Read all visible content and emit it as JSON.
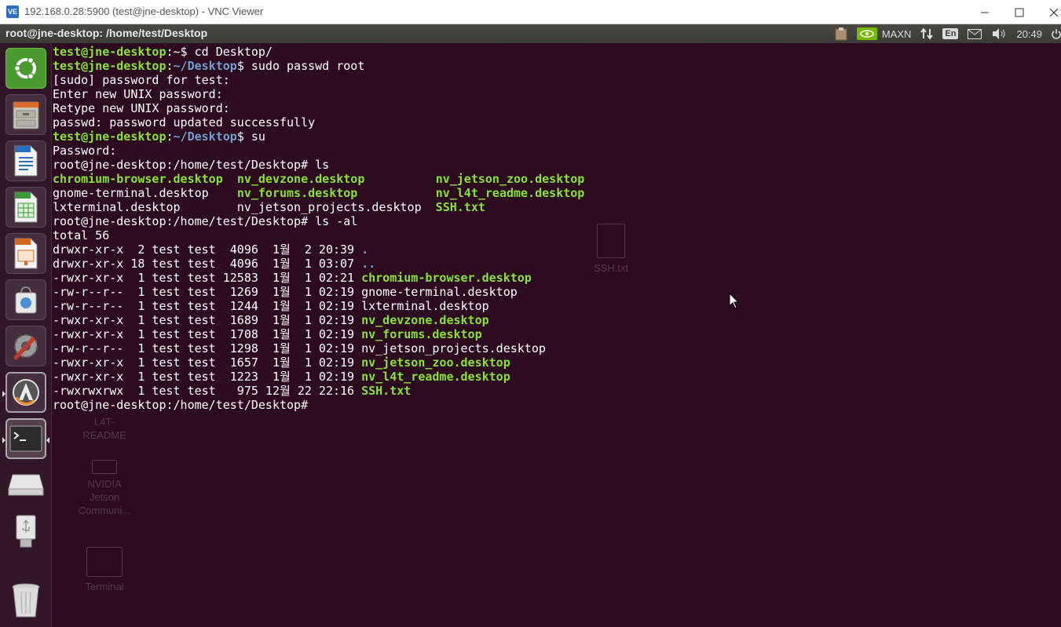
{
  "vnc_window": {
    "icon_label": "VE",
    "title": "192.168.0.28:5900 (test@jne-desktop) - VNC Viewer",
    "controls": [
      "minimize",
      "maximize",
      "close"
    ]
  },
  "top_panel": {
    "title": "root@jne-desktop: /home/test/Desktop",
    "tray": {
      "power_mode": "MAXN",
      "keyboard": "En",
      "clock": "20:49"
    }
  },
  "launcher": {
    "items": [
      {
        "name": "ubuntu-dash",
        "icon": "ubuntu-logo-icon"
      },
      {
        "name": "files",
        "icon": "file-cabinet-icon"
      },
      {
        "name": "libreoffice-writer",
        "icon": "writer-doc-icon"
      },
      {
        "name": "libreoffice-calc",
        "icon": "calc-sheet-icon"
      },
      {
        "name": "libreoffice-impress",
        "icon": "impress-slide-icon"
      },
      {
        "name": "software-center",
        "icon": "shopping-bag-icon"
      },
      {
        "name": "system-settings",
        "icon": "gear-wrench-icon"
      },
      {
        "name": "software-updater",
        "icon": "updater-icon"
      },
      {
        "name": "terminal",
        "icon": "terminal-icon"
      },
      {
        "name": "drive",
        "icon": "drive-icon"
      },
      {
        "name": "usb",
        "icon": "usb-icon"
      },
      {
        "name": "trash",
        "icon": "trash-icon"
      }
    ]
  },
  "desktop_icons": {
    "ssh": "SSH.txt",
    "l4t": [
      "L4T-",
      "README"
    ],
    "nvidia": [
      "NVIDIA",
      "Jetson",
      "Communi..."
    ],
    "terminal": "Terminal"
  },
  "colors": {
    "prompt_green": "#8ae234",
    "path_blue": "#729fcf",
    "background": "#2c0b1f",
    "panel": "#3b3a36"
  },
  "terminal": {
    "prompt_user": "test@jne-desktop",
    "lines": [
      {
        "segments": [
          [
            "g",
            "test@jne-desktop"
          ],
          [
            "w",
            ":~$ cd Desktop/"
          ]
        ]
      },
      {
        "segments": [
          [
            "g",
            "test@jne-desktop"
          ],
          [
            "w",
            ":"
          ],
          [
            "b",
            "~/Desktop"
          ],
          [
            "w",
            "$ sudo passwd root"
          ]
        ]
      },
      {
        "segments": [
          [
            "w",
            "[sudo] password for test:"
          ]
        ]
      },
      {
        "segments": [
          [
            "w",
            "Enter new UNIX password:"
          ]
        ]
      },
      {
        "segments": [
          [
            "w",
            "Retype new UNIX password:"
          ]
        ]
      },
      {
        "segments": [
          [
            "w",
            "passwd: password updated successfully"
          ]
        ]
      },
      {
        "segments": [
          [
            "g",
            "test@jne-desktop"
          ],
          [
            "w",
            ":"
          ],
          [
            "b",
            "~/Desktop"
          ],
          [
            "w",
            "$ su"
          ]
        ]
      },
      {
        "segments": [
          [
            "w",
            "Password:"
          ]
        ]
      },
      {
        "segments": [
          [
            "w",
            "root@jne-desktop:/home/test/Desktop# ls"
          ]
        ]
      },
      {
        "segments": [
          [
            "g",
            "chromium-browser.desktop"
          ],
          [
            "w",
            "  "
          ],
          [
            "g",
            "nv_devzone.desktop"
          ],
          [
            "w",
            "          "
          ],
          [
            "g",
            "nv_jetson_zoo.desktop"
          ]
        ]
      },
      {
        "segments": [
          [
            "w",
            "gnome-terminal.desktop    "
          ],
          [
            "g",
            "nv_forums.desktop"
          ],
          [
            "w",
            "           "
          ],
          [
            "g",
            "nv_l4t_readme.desktop"
          ]
        ]
      },
      {
        "segments": [
          [
            "w",
            "lxterminal.desktop        nv_jetson_projects.desktop  "
          ],
          [
            "g",
            "SSH.txt"
          ]
        ]
      },
      {
        "segments": [
          [
            "w",
            "root@jne-desktop:/home/test/Desktop# ls -al"
          ]
        ]
      },
      {
        "segments": [
          [
            "w",
            "total 56"
          ]
        ]
      },
      {
        "segments": [
          [
            "w",
            "drwxr-xr-x  2 test test  4096  1월  2 20:39 "
          ],
          [
            "b",
            "."
          ]
        ]
      },
      {
        "segments": [
          [
            "w",
            "drwxr-xr-x 18 test test  4096  1월  1 03:07 "
          ],
          [
            "b",
            ".."
          ]
        ]
      },
      {
        "segments": [
          [
            "w",
            "-rwxr-xr-x  1 test test 12583  1월  1 02:21 "
          ],
          [
            "g",
            "chromium-browser.desktop"
          ]
        ]
      },
      {
        "segments": [
          [
            "w",
            "-rw-r--r--  1 test test  1269  1월  1 02:19 gnome-terminal.desktop"
          ]
        ]
      },
      {
        "segments": [
          [
            "w",
            "-rw-r--r--  1 test test  1244  1월  1 02:19 lxterminal.desktop"
          ]
        ]
      },
      {
        "segments": [
          [
            "w",
            "-rwxr-xr-x  1 test test  1689  1월  1 02:19 "
          ],
          [
            "g",
            "nv_devzone.desktop"
          ]
        ]
      },
      {
        "segments": [
          [
            "w",
            "-rwxr-xr-x  1 test test  1708  1월  1 02:19 "
          ],
          [
            "g",
            "nv_forums.desktop"
          ]
        ]
      },
      {
        "segments": [
          [
            "w",
            "-rw-r--r--  1 test test  1298  1월  1 02:19 nv_jetson_projects.desktop"
          ]
        ]
      },
      {
        "segments": [
          [
            "w",
            "-rwxr-xr-x  1 test test  1657  1월  1 02:19 "
          ],
          [
            "g",
            "nv_jetson_zoo.desktop"
          ]
        ]
      },
      {
        "segments": [
          [
            "w",
            "-rwxr-xr-x  1 test test  1223  1월  1 02:19 "
          ],
          [
            "g",
            "nv_l4t_readme.desktop"
          ]
        ]
      },
      {
        "segments": [
          [
            "w",
            "-rwxrwxrwx  1 test test   975 12월 22 22:16 "
          ],
          [
            "g",
            "SSH.txt"
          ]
        ]
      },
      {
        "segments": [
          [
            "w",
            "root@jne-desktop:/home/test/Desktop# "
          ]
        ]
      }
    ]
  }
}
